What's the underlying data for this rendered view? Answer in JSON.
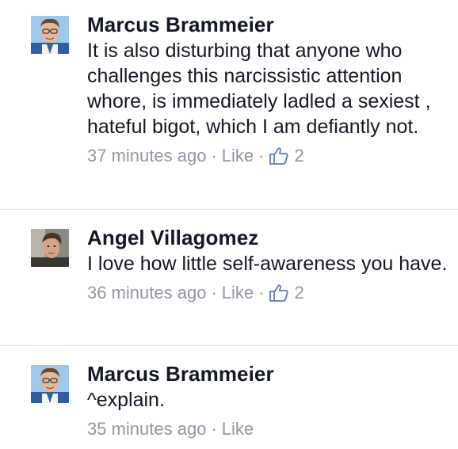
{
  "comments": [
    {
      "author": "Marcus Brammeier",
      "text": "It is also disturbing that anyone who challenges this narcissistic attention whore, is immediately ladled a sexiest , hateful bigot, which I am defiantly not.",
      "time": "37 minutes ago",
      "separator": "·",
      "like_label": "Like",
      "like_count": "2",
      "avatar_icon": "profile-photo"
    },
    {
      "author": "Angel Villagomez",
      "text": "I love how little self-awareness you have.",
      "time": "36 minutes ago",
      "separator": "·",
      "like_label": "Like",
      "like_count": "2",
      "avatar_icon": "profile-photo"
    },
    {
      "author": "Marcus Brammeier",
      "text": "^explain.",
      "time": "35 minutes ago",
      "separator": "·",
      "like_label": "Like",
      "avatar_icon": "profile-photo"
    }
  ],
  "colors": {
    "author_text": "#141823",
    "meta_text": "#9197a3",
    "divider": "#e3e5ea",
    "thumb_icon": "#5b7bb5"
  }
}
